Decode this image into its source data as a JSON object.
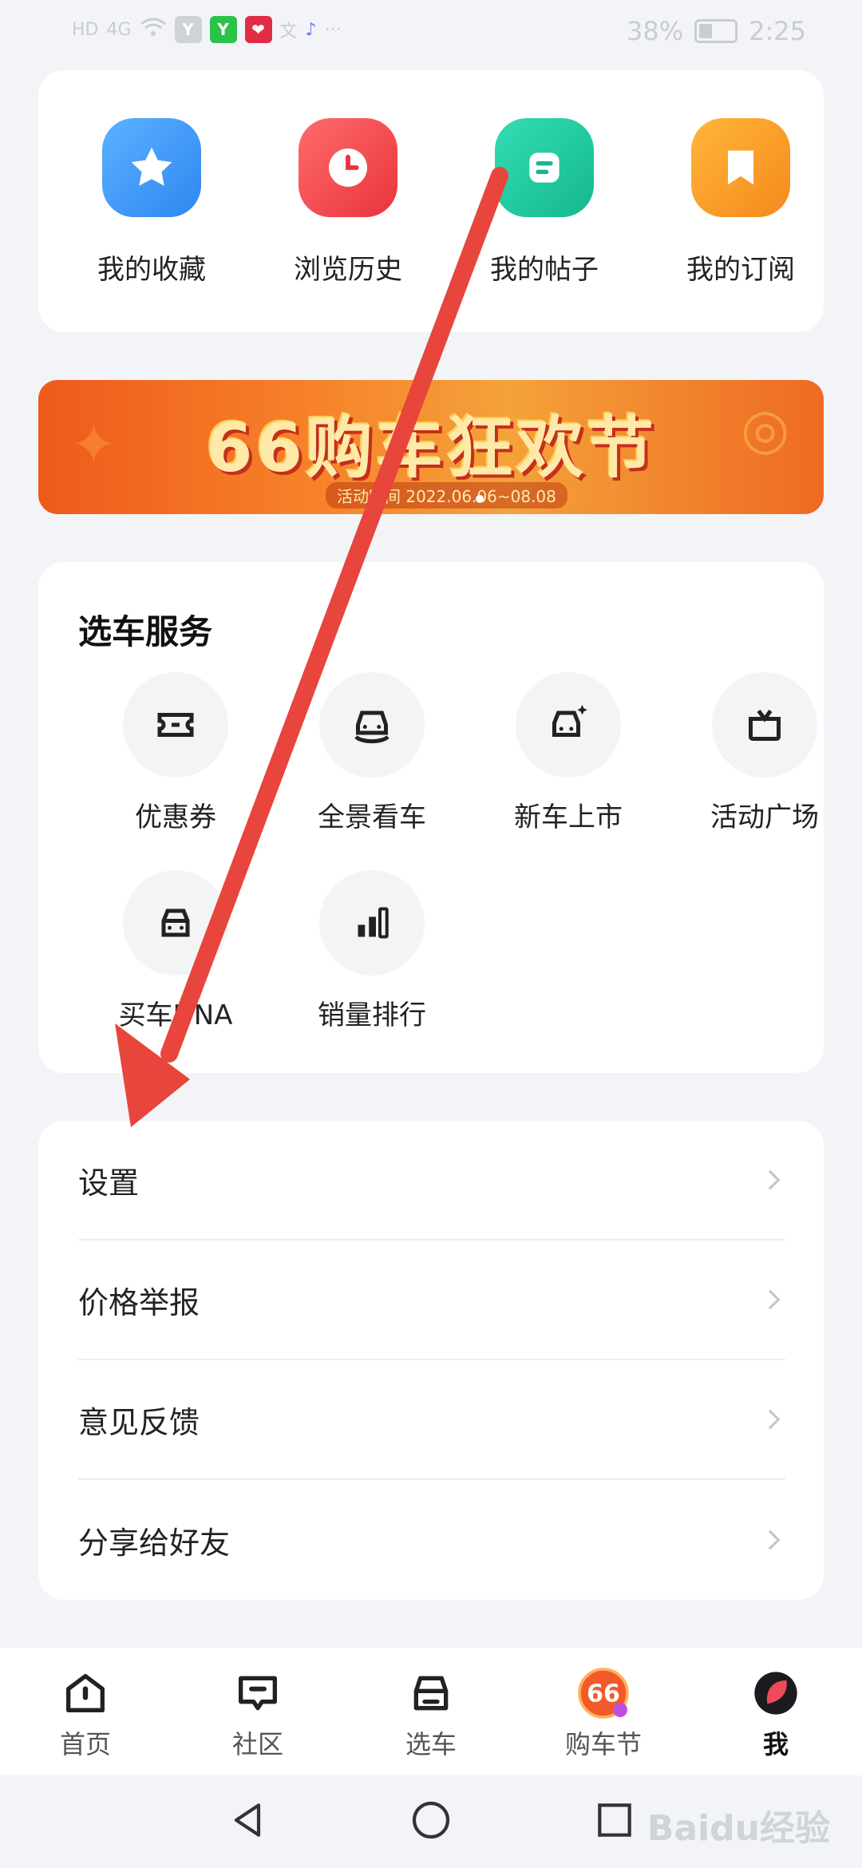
{
  "status_bar": {
    "left_items": [
      "HD",
      "4G",
      "Y",
      "Y",
      "❤",
      "文",
      "♪",
      "···"
    ],
    "battery": "38%",
    "time": "2:25"
  },
  "quick_access": [
    {
      "label": "我的收藏",
      "icon": "star-icon",
      "color": "#3d9bf5"
    },
    {
      "label": "浏览历史",
      "icon": "clock-icon",
      "color": "#f0484d"
    },
    {
      "label": "我的帖子",
      "icon": "post-icon",
      "color": "#1fc9a1"
    },
    {
      "label": "我的订阅",
      "icon": "bookmark-icon",
      "color": "#f79b20"
    }
  ],
  "banner": {
    "title": "66购车狂欢节",
    "subtitle": "活动时间 2022.06.06~08.08"
  },
  "service": {
    "title": "选车服务",
    "items": [
      {
        "label": "优惠券",
        "icon": "ticket-icon"
      },
      {
        "label": "全景看车",
        "icon": "panorama-car-icon"
      },
      {
        "label": "新车上市",
        "icon": "new-car-icon"
      },
      {
        "label": "活动广场",
        "icon": "gift-icon"
      },
      {
        "label": "买车DNA",
        "icon": "car-dna-icon"
      },
      {
        "label": "销量排行",
        "icon": "ranking-icon"
      }
    ]
  },
  "menu": [
    {
      "label": "设置"
    },
    {
      "label": "价格举报"
    },
    {
      "label": "意见反馈"
    },
    {
      "label": "分享给好友"
    }
  ],
  "tabbar": [
    {
      "label": "首页",
      "icon": "home-icon"
    },
    {
      "label": "社区",
      "icon": "community-icon"
    },
    {
      "label": "选车",
      "icon": "car-select-icon"
    },
    {
      "label": "购车节",
      "icon": "festival-66-icon"
    },
    {
      "label": "我",
      "icon": "profile-icon",
      "active": true
    }
  ],
  "watermark": "Baidu经验",
  "colors": {
    "annotation_arrow": "#e8453c",
    "page_bg": "#f2f4f8"
  }
}
